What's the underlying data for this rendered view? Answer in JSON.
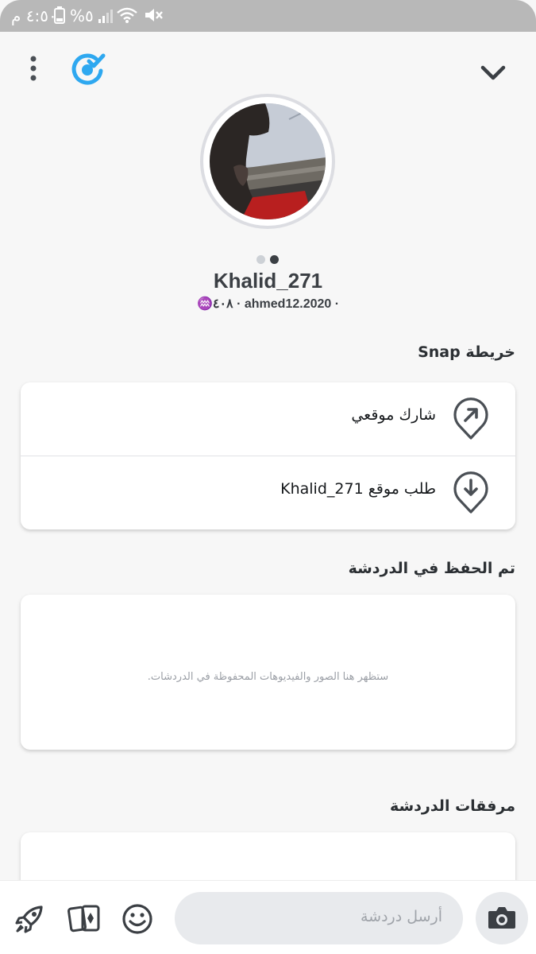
{
  "status_bar": {
    "time": "٤:٥٠ م",
    "battery_percent": "%٥"
  },
  "profile": {
    "display_name": "Khalid_271",
    "username": "ahmed12.2020",
    "snap_score": "٤٠٨",
    "zodiac_symbol": "♒"
  },
  "snap_map": {
    "title": "خريطة Snap",
    "share_location_label": "شارك موقعي",
    "request_location_label": "طلب موقع Khalid_271"
  },
  "saved_in_chat": {
    "title": "تم الحفظ في الدردشة",
    "empty_text": "ستظهر هنا الصور والفيديوهات المحفوظة في الدردشات."
  },
  "chat_attachments": {
    "title": "مرفقات الدردشة"
  },
  "bottom_bar": {
    "chat_placeholder": "أرسل دردشة"
  },
  "icons": {
    "more": "more-vertical-icon",
    "friendship": "friend-check-icon",
    "collapse": "chevron-down-icon",
    "share_location": "location-arrow-up-right-icon",
    "request_location": "location-arrow-down-icon",
    "rocket": "rocket-icon",
    "cards": "cards-icon",
    "emoji": "smiley-icon",
    "camera": "camera-icon"
  },
  "colors": {
    "accent_blue": "#2ea8f0",
    "icon_gray": "#4a4f55",
    "status_bar_bg": "#b8b8b8"
  }
}
